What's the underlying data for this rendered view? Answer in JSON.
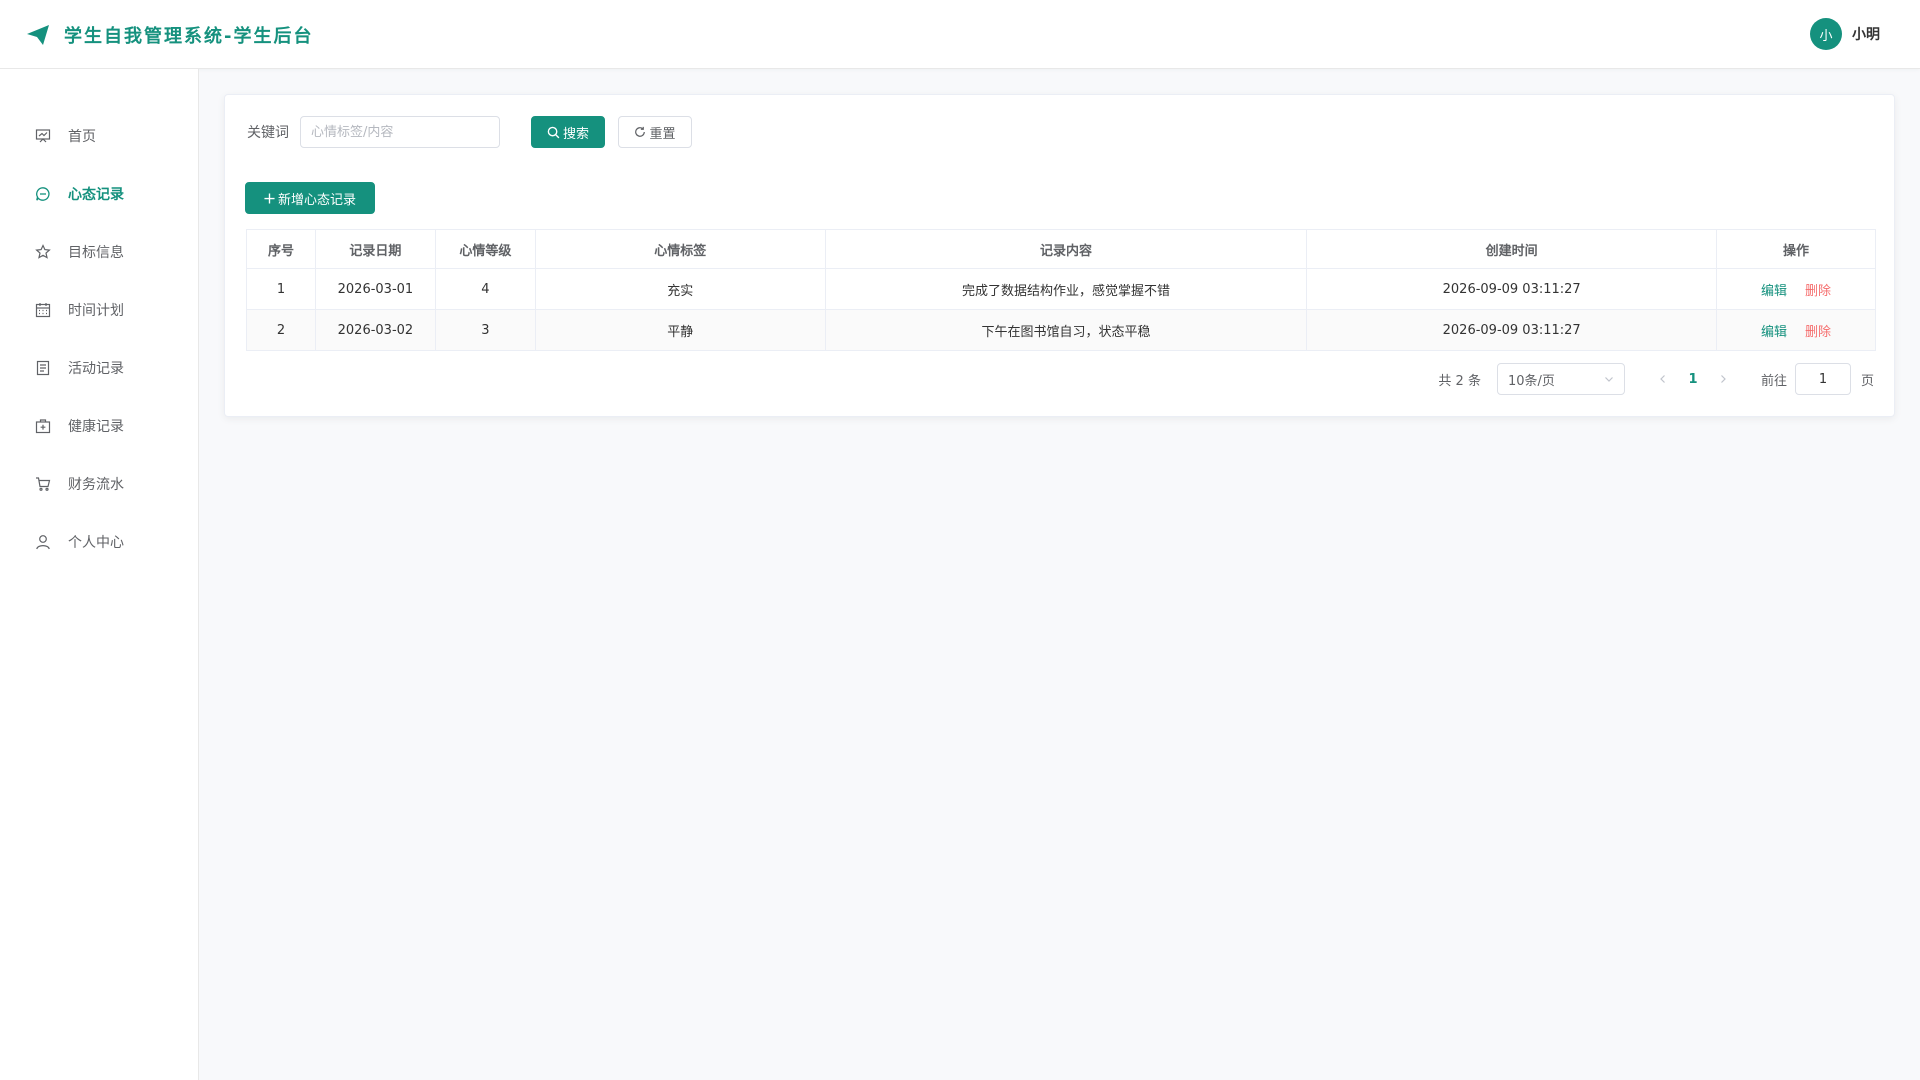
{
  "app": {
    "title": "学生自我管理系统-学生后台",
    "accent": "#15917e",
    "danger": "#f56c6c"
  },
  "user": {
    "avatar_text": "小",
    "name": "小明"
  },
  "sidebar": {
    "items": [
      {
        "label": "首页",
        "icon": "dashboard-icon",
        "active": false
      },
      {
        "label": "心态记录",
        "icon": "chat-bubble-icon",
        "active": true
      },
      {
        "label": "目标信息",
        "icon": "star-icon",
        "active": false
      },
      {
        "label": "时间计划",
        "icon": "calendar-icon",
        "active": false
      },
      {
        "label": "活动记录",
        "icon": "document-icon",
        "active": false
      },
      {
        "label": "健康记录",
        "icon": "medical-box-icon",
        "active": false
      },
      {
        "label": "财务流水",
        "icon": "cart-icon",
        "active": false
      },
      {
        "label": "个人中心",
        "icon": "user-icon",
        "active": false
      }
    ]
  },
  "search": {
    "label": "关键词",
    "value": "",
    "placeholder": "心情标签/内容",
    "search_button": "搜索",
    "reset_button": "重置"
  },
  "toolbar": {
    "add_button": "新增心态记录"
  },
  "table": {
    "headers": [
      "序号",
      "记录日期",
      "心情等级",
      "心情标签",
      "记录内容",
      "创建时间",
      "操作"
    ],
    "rows": [
      {
        "index": "1",
        "date": "2026-03-01",
        "level": "4",
        "tag": "充实",
        "content": "完成了数据结构作业，感觉掌握不错",
        "created": "2026-09-09 03:11:27"
      },
      {
        "index": "2",
        "date": "2026-03-02",
        "level": "3",
        "tag": "平静",
        "content": "下午在图书馆自习，状态平稳",
        "created": "2026-09-09 03:11:27"
      }
    ],
    "edit_label": "编辑",
    "delete_label": "删除"
  },
  "pagination": {
    "total_text": "共 2 条",
    "page_size": "10条/页",
    "current_page": "1",
    "goto_label": "前往",
    "goto_value": "1",
    "page_suffix": "页"
  }
}
